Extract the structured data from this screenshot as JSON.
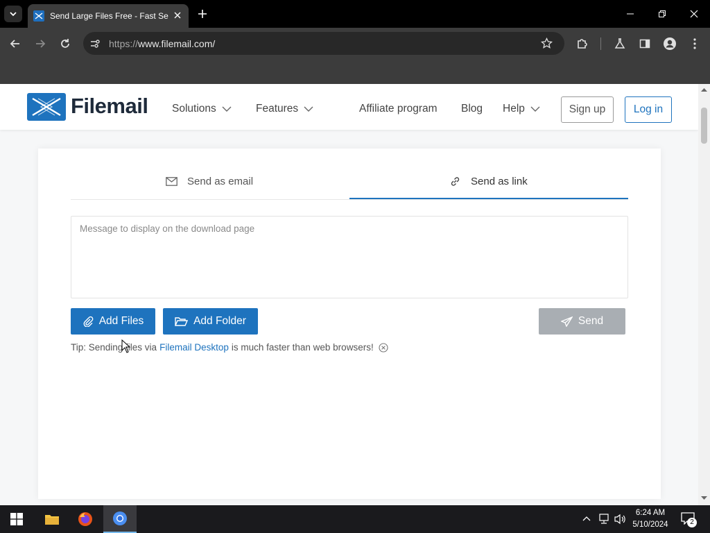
{
  "browser": {
    "tab_title": "Send Large Files Free - Fast Se",
    "url_protocol": "https://",
    "url_host": "www.filemail.com/"
  },
  "site": {
    "logo_text": "Filemail",
    "nav": {
      "solutions": "Solutions",
      "features": "Features",
      "affiliate": "Affiliate program",
      "blog": "Blog",
      "help": "Help"
    },
    "signup_label": "Sign up",
    "login_label": "Log in"
  },
  "send": {
    "tab_email": "Send as email",
    "tab_link": "Send as link",
    "active_tab": "Send as link",
    "message_placeholder": "Message to display on the download page",
    "add_files_label": "Add Files",
    "add_folder_label": "Add Folder",
    "send_label": "Send",
    "tip_prefix": "Tip: Sending files via",
    "tip_link": "Filemail Desktop",
    "tip_suffix": "is much faster than web browsers!"
  },
  "taskbar": {
    "time": "6:24 AM",
    "date": "5/10/2024",
    "notification_count": "2"
  },
  "colors": {
    "brand_blue": "#1e73be",
    "send_disabled": "#a9aeb3"
  }
}
